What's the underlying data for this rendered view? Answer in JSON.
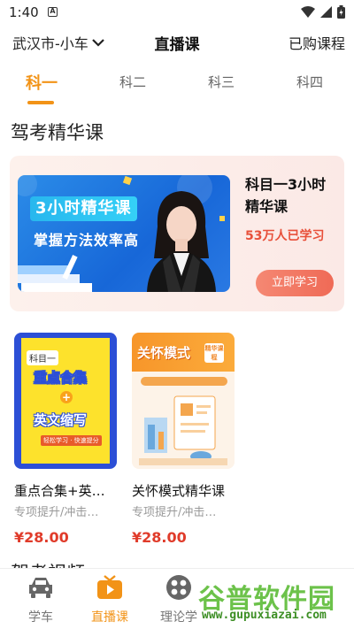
{
  "status": {
    "time": "1:40",
    "a_label": "A"
  },
  "header": {
    "city": "武汉市-小车",
    "title": "直播课",
    "purchased": "已购课程"
  },
  "tabs": [
    {
      "label": "科一",
      "active": true
    },
    {
      "label": "科二",
      "active": false
    },
    {
      "label": "科三",
      "active": false
    },
    {
      "label": "科四",
      "active": false
    }
  ],
  "section_title": "驾考精华课",
  "featured": {
    "banner_title": "3小时精华课",
    "banner_subtitle": "掌握方法效率高",
    "title": "科目一3小时精华课",
    "students": "53万人已学习",
    "button": "立即学习"
  },
  "courses": [
    {
      "name": "重点合集+英…",
      "desc": "专项提升/冲击…",
      "price": "¥28.00",
      "thumb": {
        "label": "科目一",
        "line1": "重点合集",
        "plus": "+",
        "line2": "英文缩写",
        "tags": "轻松学习 · 快速提分"
      }
    },
    {
      "name": "关怀模式精华课",
      "desc": "专项提升/冲击…",
      "price": "¥28.00",
      "thumb": {
        "title": "关怀模式",
        "badge": "精华课程"
      }
    }
  ],
  "section2_title": "驾考视频",
  "nav": [
    {
      "label": "学车",
      "icon": "car-icon",
      "active": false
    },
    {
      "label": "直播课",
      "icon": "tv-icon",
      "active": true
    },
    {
      "label": "理论学",
      "icon": "grid-icon",
      "active": false
    }
  ],
  "watermark": {
    "text": "谷普软件园",
    "url": "www.gupuxiazai.com"
  },
  "colors": {
    "accent": "#f29317",
    "price": "#e03b2a",
    "button": "#ef6a56"
  }
}
